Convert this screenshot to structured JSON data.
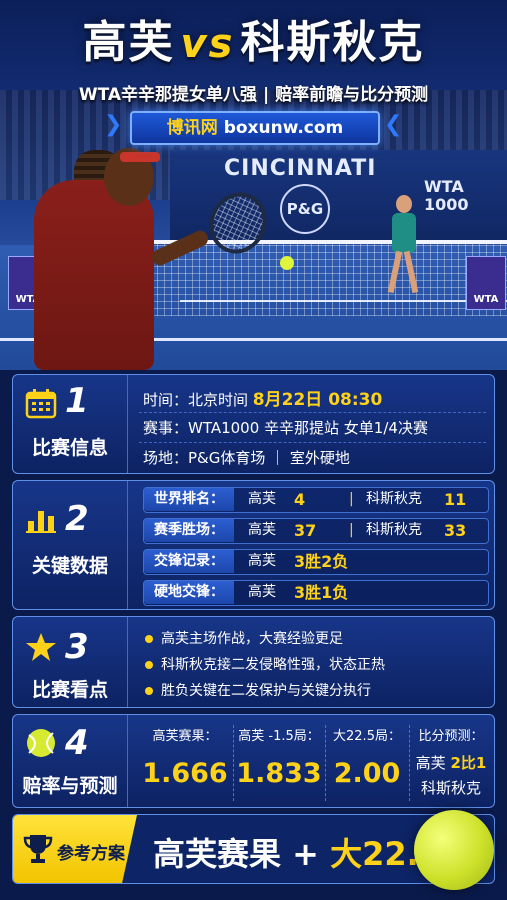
{
  "header": {
    "player_a": "高芙",
    "vs": "vs",
    "player_b": "科斯秋克",
    "subtitle": "WTA辛辛那提女单八强 | 赔率前瞻与比分预测",
    "site_cn": "博讯网",
    "site_en": "boxunw.com"
  },
  "scene": {
    "banner_text": "CINCINNATI",
    "sponsor": "P&G",
    "wta_brand": "WTA",
    "wta_level": "1000",
    "flag_text": "WTA"
  },
  "section1": {
    "num": "1",
    "title": "比赛信息",
    "time_label": "时间：北京时间",
    "time_value": "8月22日 08:30",
    "event": "赛事：WTA1000 辛辛那提站 女单1/4决赛",
    "venue": "场地：P&G体育场 ｜ 室外硬地"
  },
  "section2": {
    "num": "2",
    "title": "关键数据",
    "rows": [
      {
        "label": "世界排名：",
        "a": "高芙",
        "av": "4",
        "sep": "|",
        "b": "科斯秋克",
        "bv": "11"
      },
      {
        "label": "赛季胜场：",
        "a": "高芙",
        "av": "37",
        "sep": "|",
        "b": "科斯秋克",
        "bv": "33"
      },
      {
        "label": "交锋记录：",
        "a": "高芙",
        "av": "3胜2负"
      },
      {
        "label": "硬地交锋：",
        "a": "高芙",
        "av": "3胜1负"
      }
    ]
  },
  "section3": {
    "num": "3",
    "title": "比赛看点",
    "points": [
      "高芙主场作战，大赛经验更足",
      "科斯秋克接二发侵略性强，状态正热",
      "胜负关键在二发保护与关键分执行"
    ]
  },
  "section4": {
    "num": "4",
    "title": "赔率与预测",
    "odds": [
      {
        "label": "高芙赛果：",
        "value": "1.666"
      },
      {
        "label": "高芙 -1.5局：",
        "value": "1.833"
      },
      {
        "label": "大22.5局：",
        "value": "2.00"
      }
    ],
    "prediction_label": "比分预测：",
    "prediction_a": "高芙",
    "prediction_score": "2比1",
    "prediction_b": "科斯秋克"
  },
  "plan": {
    "label": "参考方案",
    "value_a": "高芙赛果",
    "plus": "+",
    "value_b": "大22.5"
  }
}
